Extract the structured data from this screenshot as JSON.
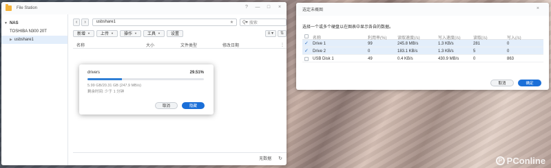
{
  "file_station": {
    "title": "File Station",
    "window_controls": [
      "?",
      "—",
      "□",
      "×"
    ],
    "tree": {
      "root": "NAS",
      "items": [
        {
          "label": "TOSHIBA N300 20T",
          "selected": false
        },
        {
          "label": "usbshare1",
          "selected": true
        }
      ]
    },
    "path": "usbshare1",
    "search_placeholder": "搜索",
    "toolbar": {
      "new": "新增",
      "upload": "上传",
      "action": "操作",
      "tools": "工具",
      "settings": "设置"
    },
    "columns": {
      "name": "名称",
      "size": "大小",
      "file_type": "文件类型",
      "modified": "修改日期"
    },
    "status": {
      "no_data": "无数据"
    }
  },
  "progress_dialog": {
    "name": "drivers",
    "percent_label": "29.51%",
    "percent": 0.2951,
    "size_text": "5.99 GB/20.31 GB (247.9 MB/s)",
    "remaining": "剩余时间: 少于 1 分钟",
    "cancel": "取消",
    "hide": "隐藏"
  },
  "disk_dialog": {
    "title": "选定未概图",
    "description": "选择一个或多个硬盘以在图表中显示各自的数据。",
    "columns": {
      "name": "名称",
      "util": "利用率(%)",
      "read": "读取速度(/s)",
      "write": "写入速度(/s)",
      "read_ops": "读取(/s)",
      "write_ops": "写入(/s)"
    },
    "rows": [
      {
        "checked": true,
        "selected": true,
        "name": "Drive 1",
        "util": "99",
        "read": "245.8 MB/s",
        "write": "1.3 KB/s",
        "read_ops": "281",
        "write_ops": "0"
      },
      {
        "checked": true,
        "selected": true,
        "name": "Drive 2",
        "util": "0",
        "read": "183.1 KB/s",
        "write": "1.3 KB/s",
        "read_ops": "5",
        "write_ops": "0"
      },
      {
        "checked": false,
        "selected": false,
        "name": "USB Disk 1",
        "util": "49",
        "read": "0.4 KB/s",
        "write": "430.9 MB/s",
        "read_ops": "0",
        "write_ops": "863"
      }
    ],
    "cancel": "取消",
    "confirm": "确定"
  },
  "watermark": {
    "text": "PConline",
    "icon": "P"
  }
}
